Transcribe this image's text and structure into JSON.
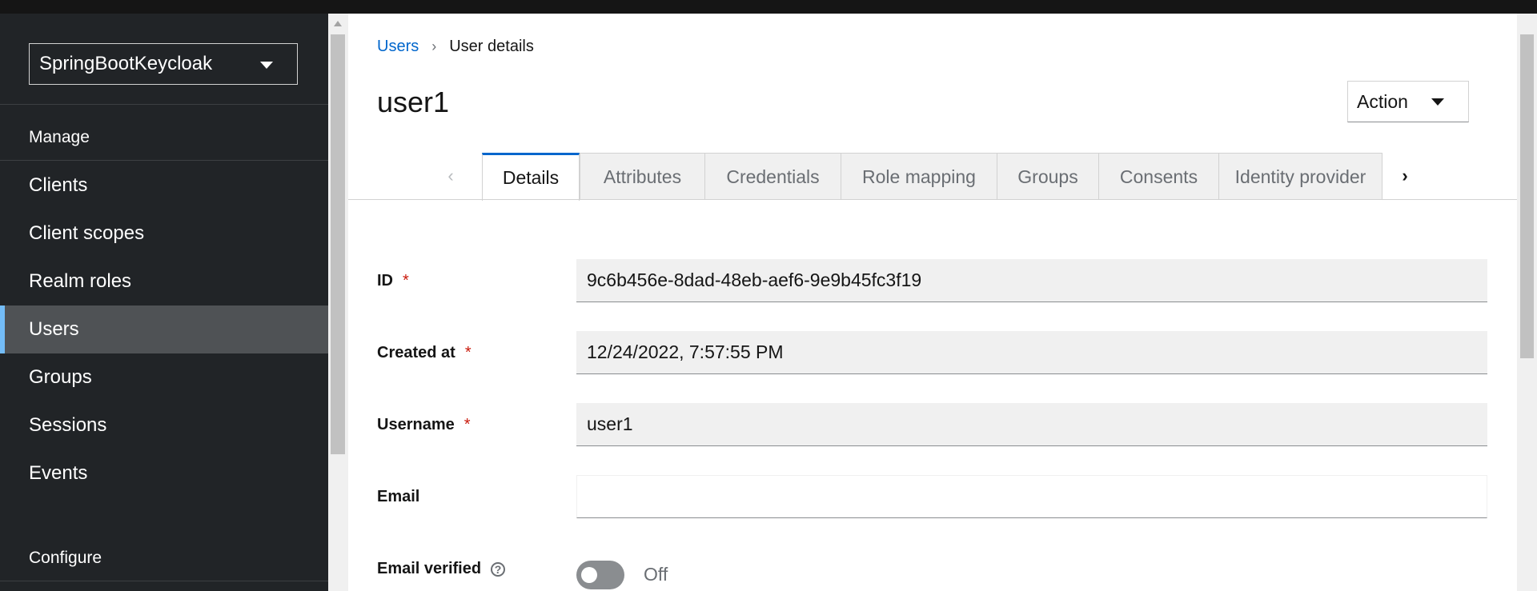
{
  "sidebar": {
    "realm": "SpringBootKeycloak",
    "section_manage": "Manage",
    "items": [
      {
        "label": "Clients"
      },
      {
        "label": "Client scopes"
      },
      {
        "label": "Realm roles"
      },
      {
        "label": "Users",
        "active": true
      },
      {
        "label": "Groups"
      },
      {
        "label": "Sessions"
      },
      {
        "label": "Events"
      }
    ],
    "section_configure": "Configure"
  },
  "breadcrumb": {
    "parent": "Users",
    "current": "User details"
  },
  "page": {
    "title": "user1",
    "action_label": "Action"
  },
  "tabs": [
    {
      "label": "Details",
      "active": true
    },
    {
      "label": "Attributes"
    },
    {
      "label": "Credentials"
    },
    {
      "label": "Role mapping"
    },
    {
      "label": "Groups"
    },
    {
      "label": "Consents"
    },
    {
      "label": "Identity provider"
    }
  ],
  "form": {
    "id": {
      "label": "ID",
      "required": "*",
      "value": "9c6b456e-8dad-48eb-aef6-9e9b45fc3f19"
    },
    "created_at": {
      "label": "Created at",
      "required": "*",
      "value": "12/24/2022, 7:57:55 PM"
    },
    "username": {
      "label": "Username",
      "required": "*",
      "value": "user1"
    },
    "email": {
      "label": "Email",
      "value": ""
    },
    "email_verified": {
      "label": "Email verified",
      "state": "Off"
    }
  },
  "colors": {
    "sidebar_bg": "#212427",
    "active_item_bg": "#4f5255",
    "active_indicator": "#73bcf7",
    "link": "#0066cc",
    "required": "#c9190b"
  }
}
